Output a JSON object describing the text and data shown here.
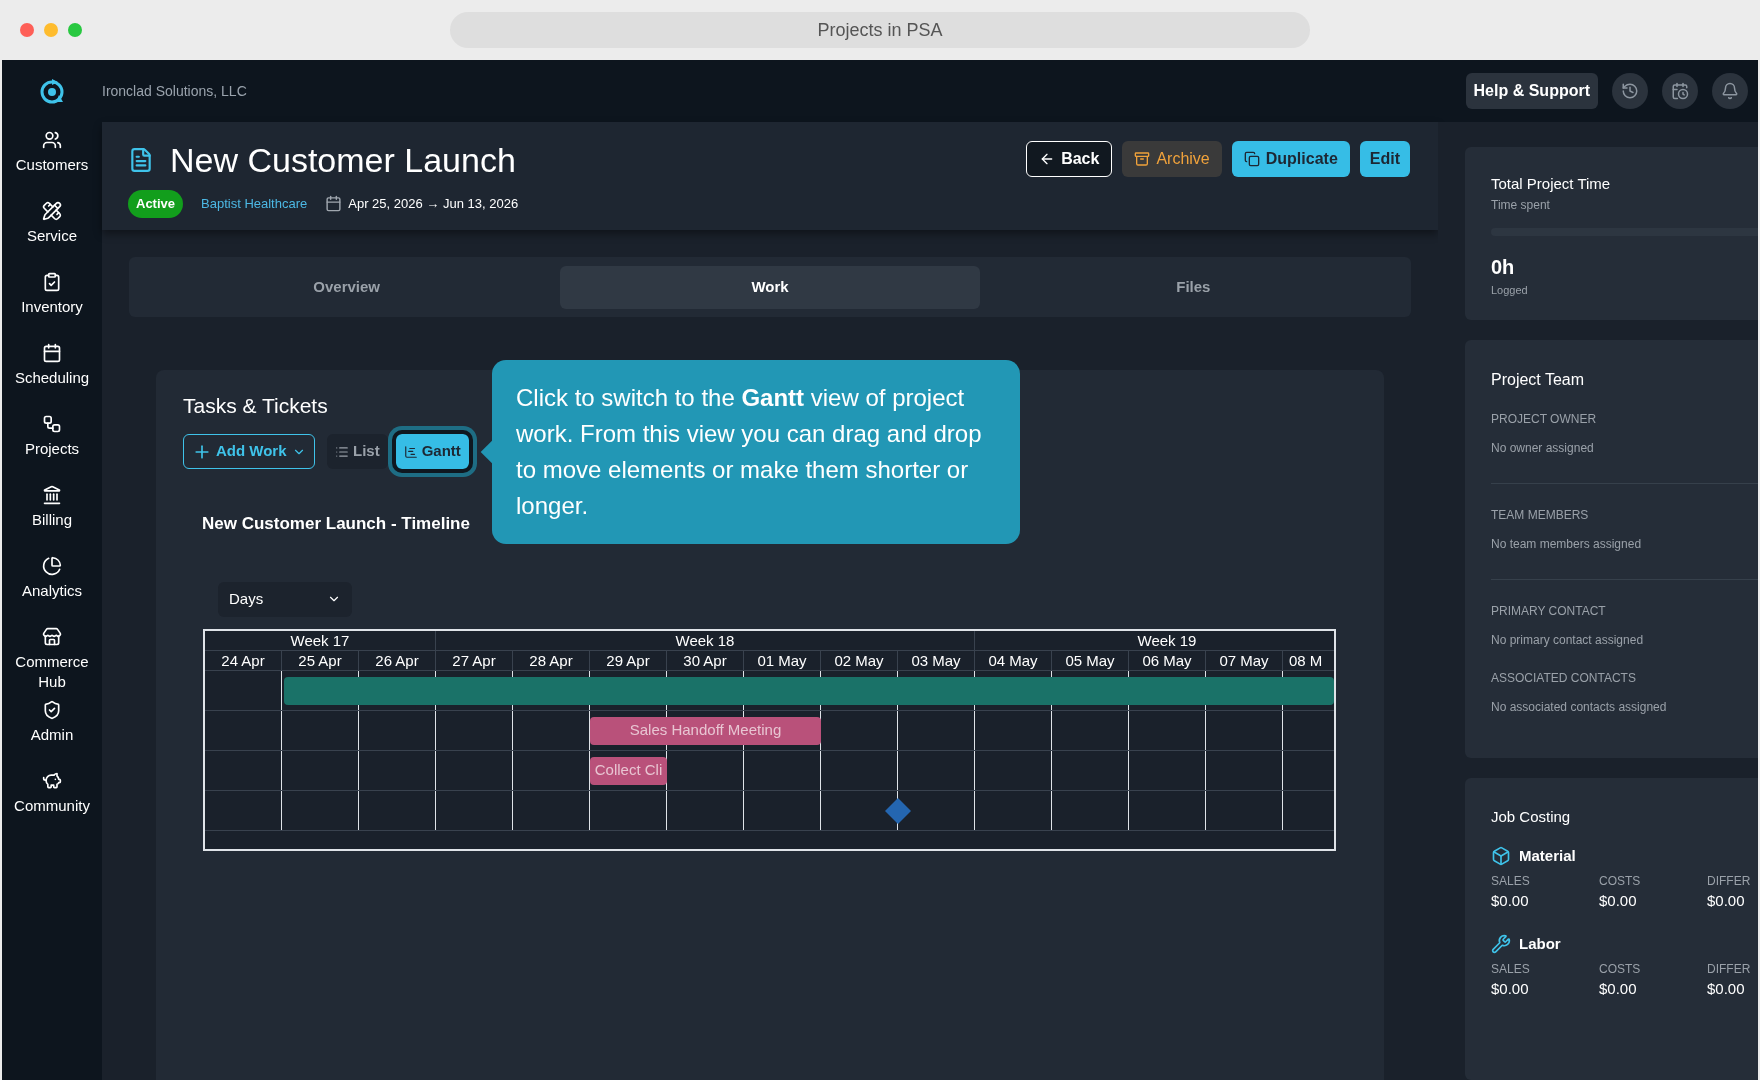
{
  "browser": {
    "address": "Projects in PSA"
  },
  "company": "Ironclad Solutions, LLC",
  "sidebar": {
    "items": [
      {
        "label": "Customers"
      },
      {
        "label": "Service"
      },
      {
        "label": "Inventory"
      },
      {
        "label": "Scheduling"
      },
      {
        "label": "Projects"
      },
      {
        "label": "Billing"
      },
      {
        "label": "Analytics"
      },
      {
        "label": "Commerce Hub"
      },
      {
        "label": "Admin"
      },
      {
        "label": "Community"
      }
    ]
  },
  "topbar": {
    "help_button": "Help & Support"
  },
  "project": {
    "title": "New Customer Launch",
    "status": "Active",
    "customer": "Baptist Healthcare",
    "dates": "Apr 25, 2026 → Jun 13, 2026",
    "actions": [
      {
        "kind": "back",
        "label": "Back"
      },
      {
        "kind": "archive",
        "label": "Archive"
      },
      {
        "kind": "duplicate",
        "label": "Duplicate"
      },
      {
        "kind": "edit",
        "label": "Edit"
      }
    ]
  },
  "tabs": [
    {
      "label": "Overview",
      "selected": false
    },
    {
      "label": "Work",
      "selected": true
    },
    {
      "label": "Files",
      "selected": false
    }
  ],
  "tasks": {
    "title": "Tasks & Tickets",
    "add_button": "Add Work",
    "views": [
      {
        "label": "List",
        "selected": false
      },
      {
        "label": "Gantt",
        "selected": true
      }
    ],
    "timeline_title": "New Customer Launch - Timeline",
    "scale": "Days",
    "weeks": [
      "Week 17",
      "Week 18",
      "Week 19"
    ],
    "days": [
      "24 Apr",
      "25 Apr",
      "26 Apr",
      "27 Apr",
      "28 Apr",
      "29 Apr",
      "30 Apr",
      "01 May",
      "02 May",
      "03 May",
      "04 May",
      "05 May",
      "06 May",
      "07 May",
      "08 M"
    ],
    "rows": [
      {
        "kind": "summary",
        "color": "#1a7268"
      },
      {
        "kind": "task",
        "label": "Sales Handoff Meeting",
        "color": "#b9517a"
      },
      {
        "kind": "task",
        "label": "Collect Cli",
        "color": "#b9517a"
      },
      {
        "kind": "milestone",
        "color": "#2466b0"
      }
    ]
  },
  "tooltip": {
    "text": "Click to switch to the **Gantt** view of project work. From this view you can drag and drop to move elements or make them shorter or longer."
  },
  "time_card": {
    "title": "Total Project Time",
    "subtitle": "Time spent",
    "value": "0h",
    "value_label": "Logged"
  },
  "team_card": {
    "title": "Project Team",
    "fields": [
      {
        "label": "PROJECT OWNER",
        "value": "No owner assigned"
      },
      {
        "label": "TEAM MEMBERS",
        "value": "No team members assigned"
      },
      {
        "label": "PRIMARY CONTACT",
        "value": "No primary contact assigned"
      },
      {
        "label": "ASSOCIATED CONTACTS",
        "value": "No associated contacts assigned"
      }
    ]
  },
  "costing_card": {
    "title": "Job Costing",
    "groups": [
      {
        "kind": "material",
        "name": "Material",
        "columns": [
          {
            "label": "SALES",
            "value": "$0.00"
          },
          {
            "label": "COSTS",
            "value": "$0.00"
          },
          {
            "label": "DIFFER",
            "value": "$0.00"
          }
        ]
      },
      {
        "kind": "labor",
        "name": "Labor",
        "columns": [
          {
            "label": "SALES",
            "value": "$0.00"
          },
          {
            "label": "COSTS",
            "value": "$0.00"
          },
          {
            "label": "DIFFER",
            "value": "$0.00"
          }
        ]
      }
    ]
  }
}
